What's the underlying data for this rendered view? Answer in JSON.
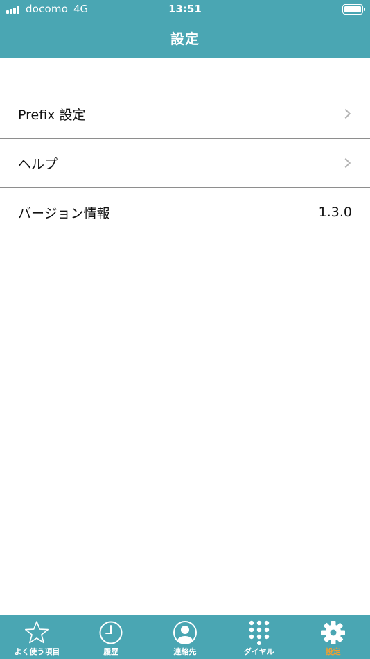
{
  "status_bar": {
    "carrier": "docomo",
    "network": "4G",
    "time": "13:51"
  },
  "nav": {
    "title": "設定"
  },
  "settings": {
    "rows": [
      {
        "label": "Prefix 設定",
        "value": ""
      },
      {
        "label": "ヘルプ",
        "value": ""
      },
      {
        "label": "バージョン情報",
        "value": "1.3.0"
      }
    ]
  },
  "tabbar": {
    "tabs": [
      {
        "label": "よく使う項目",
        "icon": "star-icon"
      },
      {
        "label": "履歴",
        "icon": "clock-icon"
      },
      {
        "label": "連絡先",
        "icon": "contact-icon"
      },
      {
        "label": "ダイヤル",
        "icon": "keypad-icon"
      },
      {
        "label": "設定",
        "icon": "gear-icon",
        "active": true
      }
    ]
  },
  "colors": {
    "header": "#4aa6b3",
    "tab_active": "#f0a030"
  }
}
